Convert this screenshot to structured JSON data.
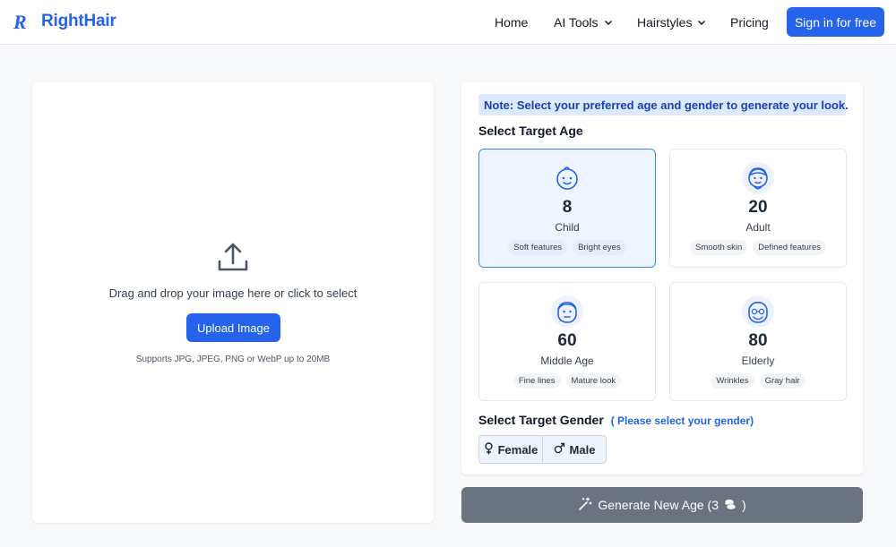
{
  "header": {
    "brand": "RightHair",
    "nav": {
      "home": "Home",
      "ai_tools": "AI Tools",
      "hairstyles": "Hairstyles",
      "pricing": "Pricing"
    },
    "signin": "Sign in for free"
  },
  "upload": {
    "drag_text": "Drag and drop your image here or click to select",
    "button": "Upload Image",
    "hint": "Supports JPG, JPEG, PNG or WebP up to 20MB"
  },
  "settings": {
    "note": "Note: Select your preferred age and gender to generate your look.",
    "age_title": "Select Target Age",
    "ages": [
      {
        "value": "8",
        "label": "Child",
        "tags": [
          "Soft features",
          "Bright eyes"
        ],
        "icon": "child-face-icon",
        "selected": true
      },
      {
        "value": "20",
        "label": "Adult",
        "tags": [
          "Smooth skin",
          "Defined features"
        ],
        "icon": "adult-face-icon",
        "selected": false
      },
      {
        "value": "60",
        "label": "Middle Age",
        "tags": [
          "Fine lines",
          "Mature look"
        ],
        "icon": "middle-age-face-icon",
        "selected": false
      },
      {
        "value": "80",
        "label": "Elderly",
        "tags": [
          "Wrinkles",
          "Gray hair"
        ],
        "icon": "elderly-face-icon",
        "selected": false
      }
    ],
    "gender_title": "Select Target Gender",
    "gender_hint": "( Please select your gender)",
    "genders": {
      "female": "Female",
      "male": "Male"
    },
    "generate": "Generate New Age (3",
    "generate_end": ")"
  },
  "colors": {
    "accent": "#2563eb",
    "note_bg": "#dbeafe",
    "note_text": "#1e40af",
    "generate_bg": "#6b7280"
  }
}
